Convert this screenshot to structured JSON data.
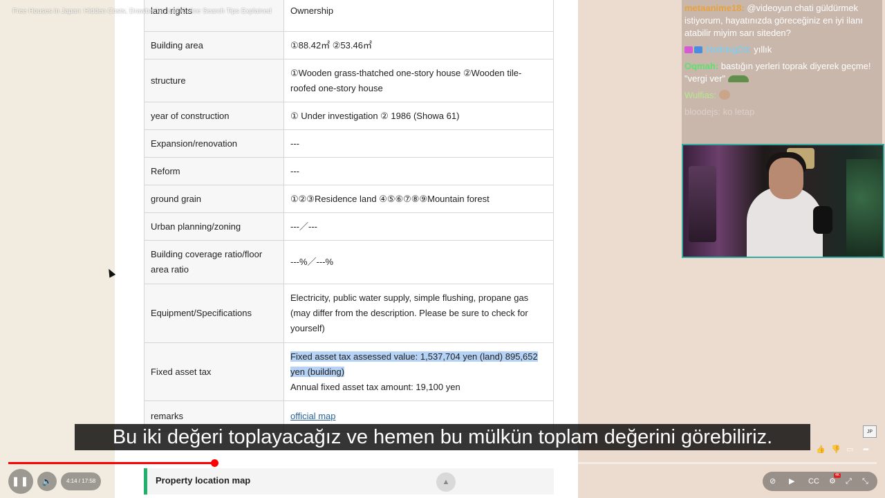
{
  "video": {
    "title": "Free Houses in Japan: Hidden Costs, Drawbacks, and Online Search Tips Explained",
    "subtitle": "Bu iki değeri toplayacağız ve hemen bu mülkün toplam değerini görebiliriz.",
    "time": "4:14 / 17:58",
    "progress": 0.237,
    "hd_badge": "4K"
  },
  "table": {
    "rows": [
      {
        "key": "land rights",
        "value": "Ownership"
      },
      {
        "key": "Building area",
        "value": "①88.42㎡ ②53.46㎡"
      },
      {
        "key": "structure",
        "value": "①Wooden grass-thatched one-story house ②Wooden tile-roofed one-story house"
      },
      {
        "key": "year of construction",
        "value": "① Under investigation ② 1986 (Showa 61)"
      },
      {
        "key": "Expansion/renovation",
        "value": "---"
      },
      {
        "key": "Reform",
        "value": "---"
      },
      {
        "key": "ground grain",
        "value": "①②③Residence land ④⑤⑥⑦⑧⑨Mountain forest"
      },
      {
        "key": "Urban planning/zoning",
        "value": "---／---"
      },
      {
        "key": "Building coverage ratio/floor area ratio",
        "value": "---%／---%"
      },
      {
        "key": "Equipment/Specifications",
        "value": "Electricity, public water supply, simple flushing, propane gas (may differ from the description. Please be sure to check for yourself)"
      },
      {
        "key": "Fixed asset tax",
        "value_highlight": "Fixed asset tax assessed value: 1,537,704 yen (land) 895,652 yen (building)",
        "value_extra": "Annual fixed asset tax amount: 19,100 yen"
      },
      {
        "key": "remarks",
        "link": "official map"
      }
    ]
  },
  "location_bar": {
    "title": "Property location map"
  },
  "chat": {
    "messages": [
      {
        "user": "metaanime18:",
        "text": "@videoyun chati güldürmek istiyorum, hayatınızda göreceğiniz en iyi ilanı atabilir miyim sarı siteden?"
      },
      {
        "user": "NothingD3:",
        "text": "yıllık"
      },
      {
        "user": "Oqmah:",
        "text": "bastığın yerleri toprak diyerek geçme! \"vergi ver\""
      },
      {
        "user": "Wulfias:",
        "text": ""
      },
      {
        "user": "bloodejs:",
        "text": "ko letap"
      }
    ]
  }
}
